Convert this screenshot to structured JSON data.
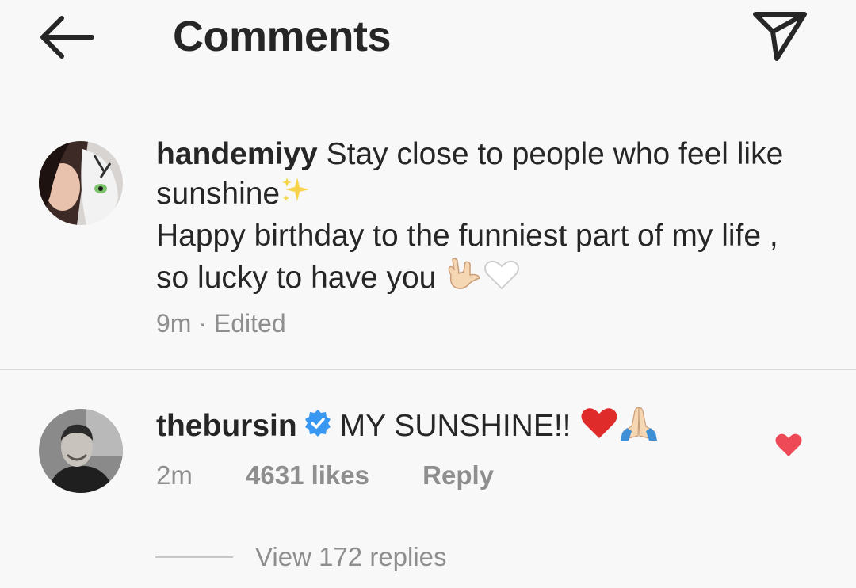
{
  "header": {
    "title": "Comments",
    "back_icon": "arrow-left-icon",
    "send_icon": "paper-plane-icon"
  },
  "caption": {
    "username": "handemiyy",
    "text_line1": "Stay close to people who feel like sunshine",
    "text_line2": "Happy birthday to the funniest part of my life , so lucky to have you",
    "time": "9m",
    "separator": "·",
    "edited": "Edited"
  },
  "comment": {
    "username": "thebursin",
    "verified": true,
    "text": "MY SUNSHINE!!",
    "time": "2m",
    "likes": "4631 likes",
    "reply": "Reply",
    "liked": true
  },
  "replies": {
    "label": "View 172 replies"
  },
  "colors": {
    "background": "#f8f8f8",
    "text": "#262626",
    "muted": "#8e8e8e",
    "verified": "#3897f0",
    "heart": "#ed4956",
    "divider": "#dbdbdb"
  }
}
